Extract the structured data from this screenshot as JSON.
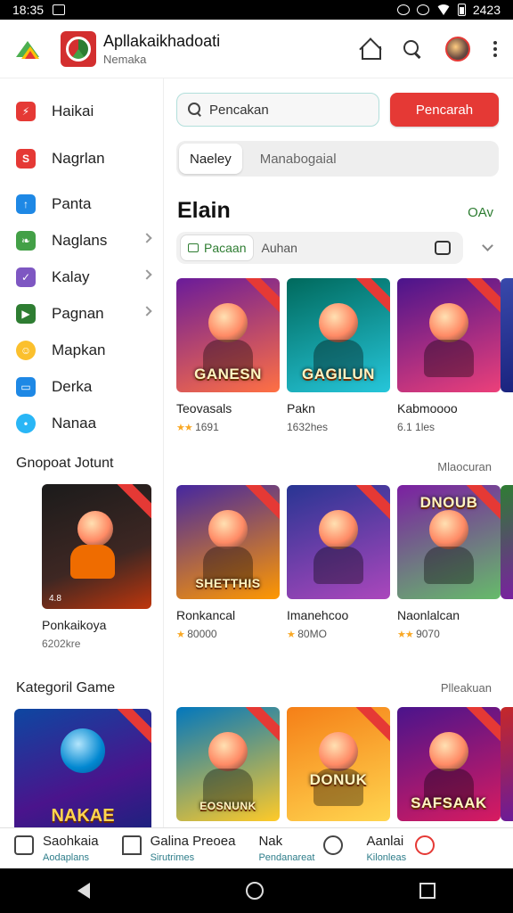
{
  "status_bar": {
    "time": "18:35",
    "right_text": "2423"
  },
  "app_bar": {
    "title": "Apllakaikhadoati",
    "subtitle": "Nemaka"
  },
  "sidebar": {
    "items": [
      {
        "label": "Haikai",
        "icon": "bolt-icon",
        "color": "#e53935"
      },
      {
        "label": "Nagrlan",
        "icon": "fire-icon",
        "color": "#e53935"
      },
      {
        "label": "Panta",
        "icon": "arrow-icon",
        "color": "#1e88e5"
      },
      {
        "label": "Naglans",
        "icon": "leaf-icon",
        "color": "#43a047"
      },
      {
        "label": "Kalay",
        "icon": "check-icon",
        "color": "#7e57c2"
      },
      {
        "label": "Pagnan",
        "icon": "flag-icon",
        "color": "#2e7d32"
      },
      {
        "label": "Mapkan",
        "icon": "smile-icon",
        "color": "#fbc02d"
      },
      {
        "label": "Derka",
        "icon": "card-icon",
        "color": "#1e88e5"
      },
      {
        "label": "Nanaa",
        "icon": "chat-icon",
        "color": "#29b6f6"
      }
    ],
    "section_label": "Gnopoat Jotunt",
    "featured": {
      "title": "Ponkaikoya",
      "sub": "6202kre",
      "badge": "4.8"
    },
    "category_label": "Kategoril Game",
    "category_card": {
      "logo": "NAKAE"
    }
  },
  "search": {
    "placeholder": "Pencakan",
    "button": "Pencarah"
  },
  "tabs": [
    "Naeley",
    "Manabogaial"
  ],
  "section": {
    "title": "Elain",
    "link": "OAv"
  },
  "filter": {
    "chip": "Pacaan",
    "text": "Auhan"
  },
  "row1": [
    {
      "title": "Teovasals",
      "rating": "1691",
      "logo": "GANESN",
      "c1": "#6a1b9a",
      "c2": "#ff7043"
    },
    {
      "title": "Pakn",
      "rating": "1632hes",
      "logo": "GAGILUN",
      "c1": "#00695c",
      "c2": "#26c6da"
    },
    {
      "title": "Kabmoooo",
      "rating": "6.1 1les",
      "logo": "",
      "c1": "#4a148c",
      "c2": "#ec407a"
    }
  ],
  "row1_more_label": "Mlaocuran",
  "row2": [
    {
      "title": "Ronkancal",
      "rating": "80000",
      "logo": "SHETTHIS",
      "c1": "#4527a0",
      "c2": "#ff9800"
    },
    {
      "title": "Imanehcoo",
      "rating": "80MO",
      "logo": "",
      "c1": "#283593",
      "c2": "#ab47bc"
    },
    {
      "title": "Naonlalcan",
      "rating": "9070",
      "logo": "DNOUB",
      "c1": "#7b1fa2",
      "c2": "#66bb6a"
    }
  ],
  "row2_more_label": "Plleakuan",
  "row3": [
    {
      "logo": "EOSNUNK",
      "c1": "#0277bd",
      "c2": "#ffca28"
    },
    {
      "logo": "DONUK",
      "c1": "#f57f17",
      "c2": "#ffd54f"
    },
    {
      "logo": "SAFSAAK",
      "c1": "#4a148c",
      "c2": "#d81b60"
    }
  ],
  "bottom_nav": [
    {
      "label": "Saohkaia",
      "sub": "Aodaplans"
    },
    {
      "label": "Galina Preoea",
      "sub": "Sirutrimes"
    },
    {
      "label": "Nak",
      "sub": "Pendanareat"
    },
    {
      "label": "Aanlai",
      "sub": "Kilonleas"
    }
  ],
  "colors": {
    "accent": "#e53935",
    "green": "#2e7d32"
  }
}
